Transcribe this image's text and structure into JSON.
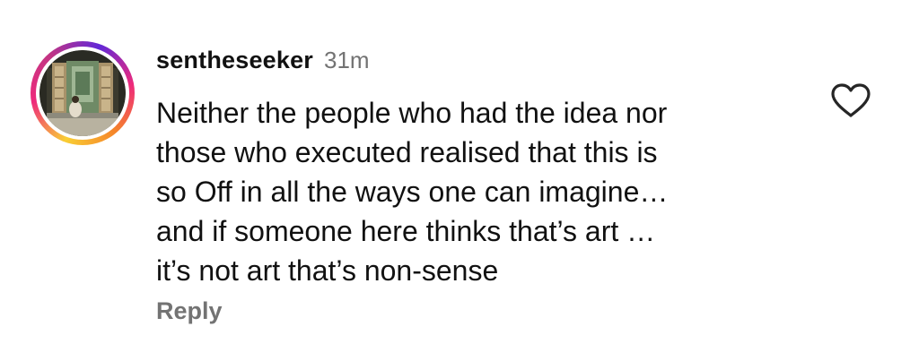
{
  "comment": {
    "username": "sentheseeker",
    "timestamp": "31m",
    "text_lines": [
      "Neither the people who had the idea nor",
      "those who executed realised that this is",
      "so Off in all the ways one can imagine…",
      "and if someone here thinks that’s art …",
      "it’s not art that’s non-sense"
    ],
    "reply_label": "Reply",
    "avatar_ring_colors": [
      "#f9ce34",
      "#ee2a7b",
      "#6228d7"
    ],
    "like_icon": "heart-outline-icon"
  }
}
